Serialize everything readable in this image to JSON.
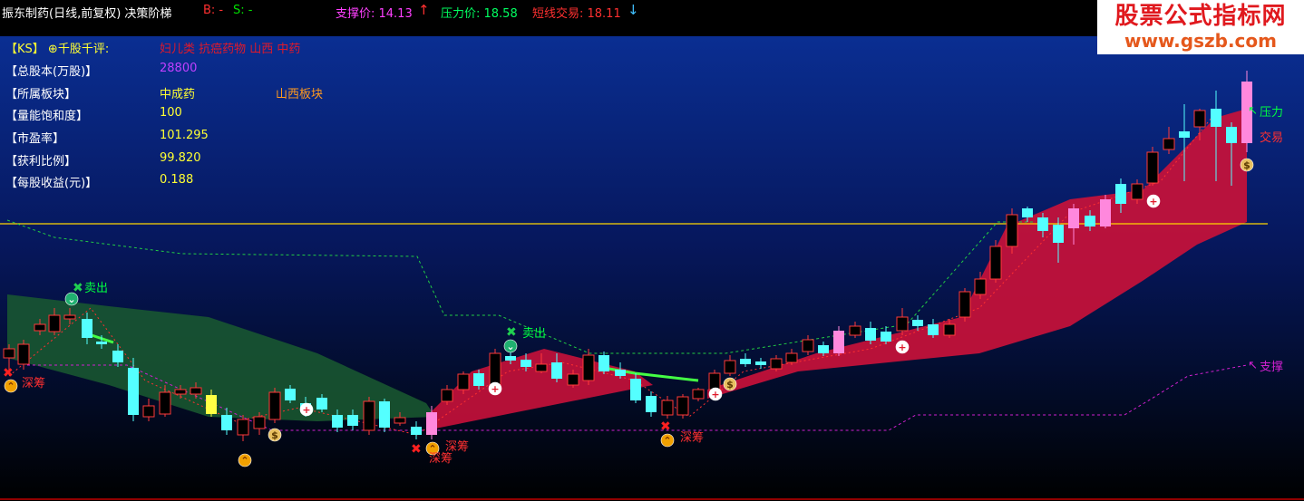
{
  "header": {
    "title": "振东制药(日线,前复权) 决策阶梯",
    "b_label": "B: -",
    "s_label": "S: -",
    "support": "支撑价: 14.13",
    "pressure": "压力价: 18.58",
    "short_trade": "短线交易: 18.11",
    "up_arrow": "↑",
    "down_arrow": "↓"
  },
  "watermark": {
    "title": "股票公式指标网",
    "url": "www.gszb.com"
  },
  "info_panel": {
    "rows": [
      {
        "label": "【KS】",
        "label2": "⊕千股千评:",
        "value": "妇儿类 抗癌药物 山西 中药",
        "value_color": "#e0192a"
      },
      {
        "label": "【总股本(万股)】",
        "value": "28800",
        "value_color": "#c040ff"
      },
      {
        "label": "【所属板块】",
        "value": "中成药",
        "value_color": "#ffff33",
        "value2": "山西板块",
        "value2_color": "#ff9a1e"
      },
      {
        "label": "【量能饱和度】",
        "value": "100",
        "value_color": "#ffff33"
      },
      {
        "label": "【市盈率】",
        "value": "101.295",
        "value_color": "#ffff33"
      },
      {
        "label": "【获利比例】",
        "value": "99.820",
        "value_color": "#ffff33"
      },
      {
        "label": "【每股收益(元)】",
        "value": "0.188",
        "value_color": "#ffff33"
      }
    ]
  },
  "annotations": {
    "sell": "卖出",
    "deep_buy": "深筹",
    "pressure": "压力",
    "trade": "交易",
    "support": "支撑"
  },
  "colors": {
    "up_candle": "#ff3a3a",
    "down_candle": "#54ffff",
    "pink_candle": "#ff88dd",
    "yellow_candle": "#ffff44",
    "red_band": "#c8113a",
    "green_band": "#1a5a30",
    "support_line": "#d020d0",
    "horizontal_line": "#ffd700"
  }
}
